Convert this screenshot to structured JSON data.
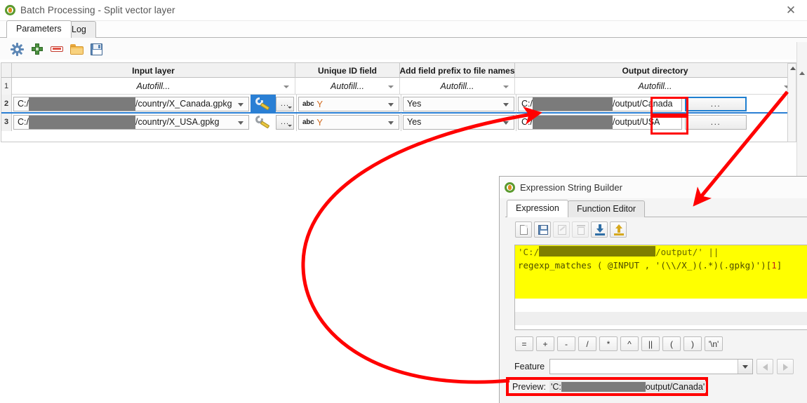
{
  "window": {
    "title": "Batch Processing - Split vector layer",
    "logo_icon": "qgis-logo-icon",
    "close_icon": "close-icon"
  },
  "tabs": [
    {
      "label": "Parameters",
      "active": true
    },
    {
      "label": "Log",
      "active": false
    }
  ],
  "toolbar": {
    "buttons": [
      {
        "name": "advanced-parameters-button",
        "icon": "gear-icon"
      },
      {
        "name": "add-row-button",
        "icon": "plus-icon"
      },
      {
        "name": "remove-row-button",
        "icon": "minus-icon"
      },
      {
        "name": "open-button",
        "icon": "folder-icon"
      },
      {
        "name": "save-button",
        "icon": "floppy-disk-icon"
      }
    ]
  },
  "table": {
    "columns": [
      "Input layer",
      "Unique ID field",
      "Add field prefix to file names",
      "Output directory"
    ],
    "autofill_label": "Autofill...",
    "row_numbers": [
      "1",
      "2",
      "3"
    ],
    "rows": [
      {
        "number": "2",
        "input_layer_prefix": "C:/",
        "input_layer_suffix": "/country/X_Canada.gpkg",
        "unique_id_prefix": "abc",
        "unique_id_value": "Y",
        "field_prefix": "Yes",
        "output_prefix": "C:/",
        "output_suffix": "/output/",
        "output_name": "Canada",
        "browse_label": "...",
        "selected": true
      },
      {
        "number": "3",
        "input_layer_prefix": "C:/",
        "input_layer_suffix": "/country/X_USA.gpkg",
        "unique_id_prefix": "abc",
        "unique_id_value": "Y",
        "field_prefix": "Yes",
        "output_prefix": "C:/",
        "output_suffix": "/output/",
        "output_name": "USA",
        "browse_label": "...",
        "selected": false
      }
    ]
  },
  "expression_dialog": {
    "title": "Expression String Builder",
    "logo_icon": "qgis-logo-icon",
    "tabs": [
      {
        "label": "Expression",
        "active": true
      },
      {
        "label": "Function Editor",
        "active": false
      }
    ],
    "toolbar_buttons": [
      {
        "name": "new-expression-button",
        "icon": "new-document-icon",
        "enabled": true
      },
      {
        "name": "save-expression-button",
        "icon": "floppy-disk-icon",
        "enabled": true
      },
      {
        "name": "edit-expression-button",
        "icon": "pencil-icon",
        "enabled": false
      },
      {
        "name": "delete-expression-button",
        "icon": "trash-icon",
        "enabled": false
      },
      {
        "name": "import-expression-button",
        "icon": "import-arrow-icon",
        "enabled": true
      },
      {
        "name": "export-expression-button",
        "icon": "export-arrow-icon",
        "enabled": true
      }
    ],
    "expression_lines": [
      {
        "segments": [
          {
            "text": "'C:/",
            "style": "str"
          },
          {
            "text": "",
            "style": "redact"
          },
          {
            "text": "/output/' ||",
            "style": "str"
          }
        ]
      },
      {
        "segments": [
          {
            "text": "regexp_matches ( @INPUT , '(\\\\\\\\/X_)(.*)(.gpkg)')[",
            "style": "fn"
          },
          {
            "text": "1",
            "style": "idx"
          },
          {
            "text": "]",
            "style": "fn"
          }
        ]
      }
    ],
    "operator_buttons": [
      "=",
      "+",
      "-",
      "/",
      "*",
      "^",
      "||",
      "(",
      ")",
      "'\\n'"
    ],
    "feature_label": "Feature",
    "feature_value": "",
    "prev_button_icon": "triangle-left-icon",
    "next_button_icon": "triangle-right-icon",
    "preview_label": "Preview:",
    "preview_prefix": "'C:",
    "preview_suffix": "output/Canada'"
  },
  "annotations": {
    "highlight_color": "#ff0000",
    "boxed_values": [
      "Canada",
      "USA"
    ],
    "preview_boxed": true
  }
}
